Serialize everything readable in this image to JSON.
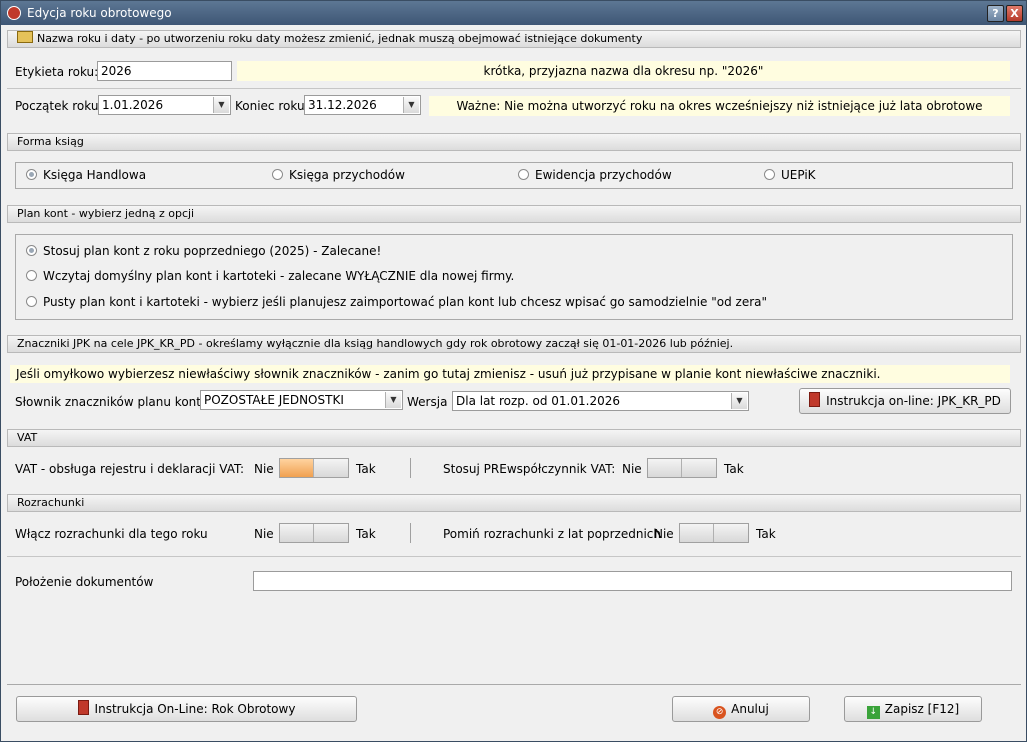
{
  "window": {
    "title": "Edycja roku obrotowego",
    "help_glyph": "?",
    "close_glyph": "X"
  },
  "section_name": {
    "header": "Nazwa roku i daty - po utworzeniu roku daty możesz zmienić, jednak muszą obejmować istniejące dokumenty",
    "label_label": "Etykieta roku:",
    "label_value": "2026",
    "label_hint": "krótka, przyjazna nazwa dla okresu np. \"2026\"",
    "start_label": "Początek roku",
    "start_value": "1.01.2026",
    "end_label": "Koniec roku",
    "end_value": "31.12.2026",
    "date_hint": "Ważne: Nie można utworzyć roku na okres wcześniejszy niż istniejące już lata obrotowe"
  },
  "section_books": {
    "header": "Forma ksiąg",
    "options": [
      "Księga Handlowa",
      "Księga przychodów",
      "Ewidencja przychodów",
      "UEPiK"
    ],
    "selected": 0
  },
  "section_plan": {
    "header": "Plan kont - wybierz jedną z opcji",
    "options": [
      "Stosuj plan kont z roku poprzedniego (2025) - Zalecane!",
      "Wczytaj domyślny plan kont i kartoteki - zalecane WYŁĄCZNIE dla nowej firmy.",
      "Pusty plan kont i kartoteki - wybierz jeśli planujesz zaimportować plan kont lub chcesz wpisać go samodzielnie \"od zera\""
    ],
    "selected": 0
  },
  "section_jpk": {
    "header": "Znaczniki JPK na cele JPK_KR_PD - określamy wyłącznie dla ksiąg handlowych gdy rok obrotowy zaczął się 01-01-2026 lub później.",
    "warning": "Jeśli omyłkowo wybierzesz niewłaściwy słownik znaczników - zanim go tutaj zmienisz - usuń już przypisane w planie kont niewłaściwe znaczniki.",
    "dict_label": "Słownik znaczników planu kont:",
    "dict_value": "POZOSTAŁE JEDNOSTKI",
    "version_label": "Wersja",
    "version_value": "Dla lat rozp. od 01.01.2026",
    "instruction_button": "Instrukcja on-line: JPK_KR_PD"
  },
  "section_vat": {
    "header": "VAT",
    "vat_label": "VAT - obsługa rejestru i deklaracji VAT:",
    "vat_state": "Nie",
    "prew_label": "Stosuj PREwspółczynnik VAT:",
    "prew_state": "Nie",
    "no": "Nie",
    "yes": "Tak"
  },
  "section_settlements": {
    "header": "Rozrachunki",
    "enable_label": "Włącz rozrachunki dla tego roku",
    "enable_state": "Nie",
    "skip_label": "Pomiń rozrachunki z lat poprzednich",
    "skip_state": "Nie",
    "no": "Nie",
    "yes": "Tak"
  },
  "location": {
    "label": "Położenie dokumentów",
    "value": ""
  },
  "footer": {
    "instruction_button": "Instrukcja On-Line: Rok Obrotowy",
    "cancel_button": "Anuluj",
    "save_button": "Zapisz [F12]"
  },
  "colors": {
    "titlebar": "#4a6483",
    "hint_bg": "#fffde0",
    "toggle_on": "#f0a050"
  }
}
